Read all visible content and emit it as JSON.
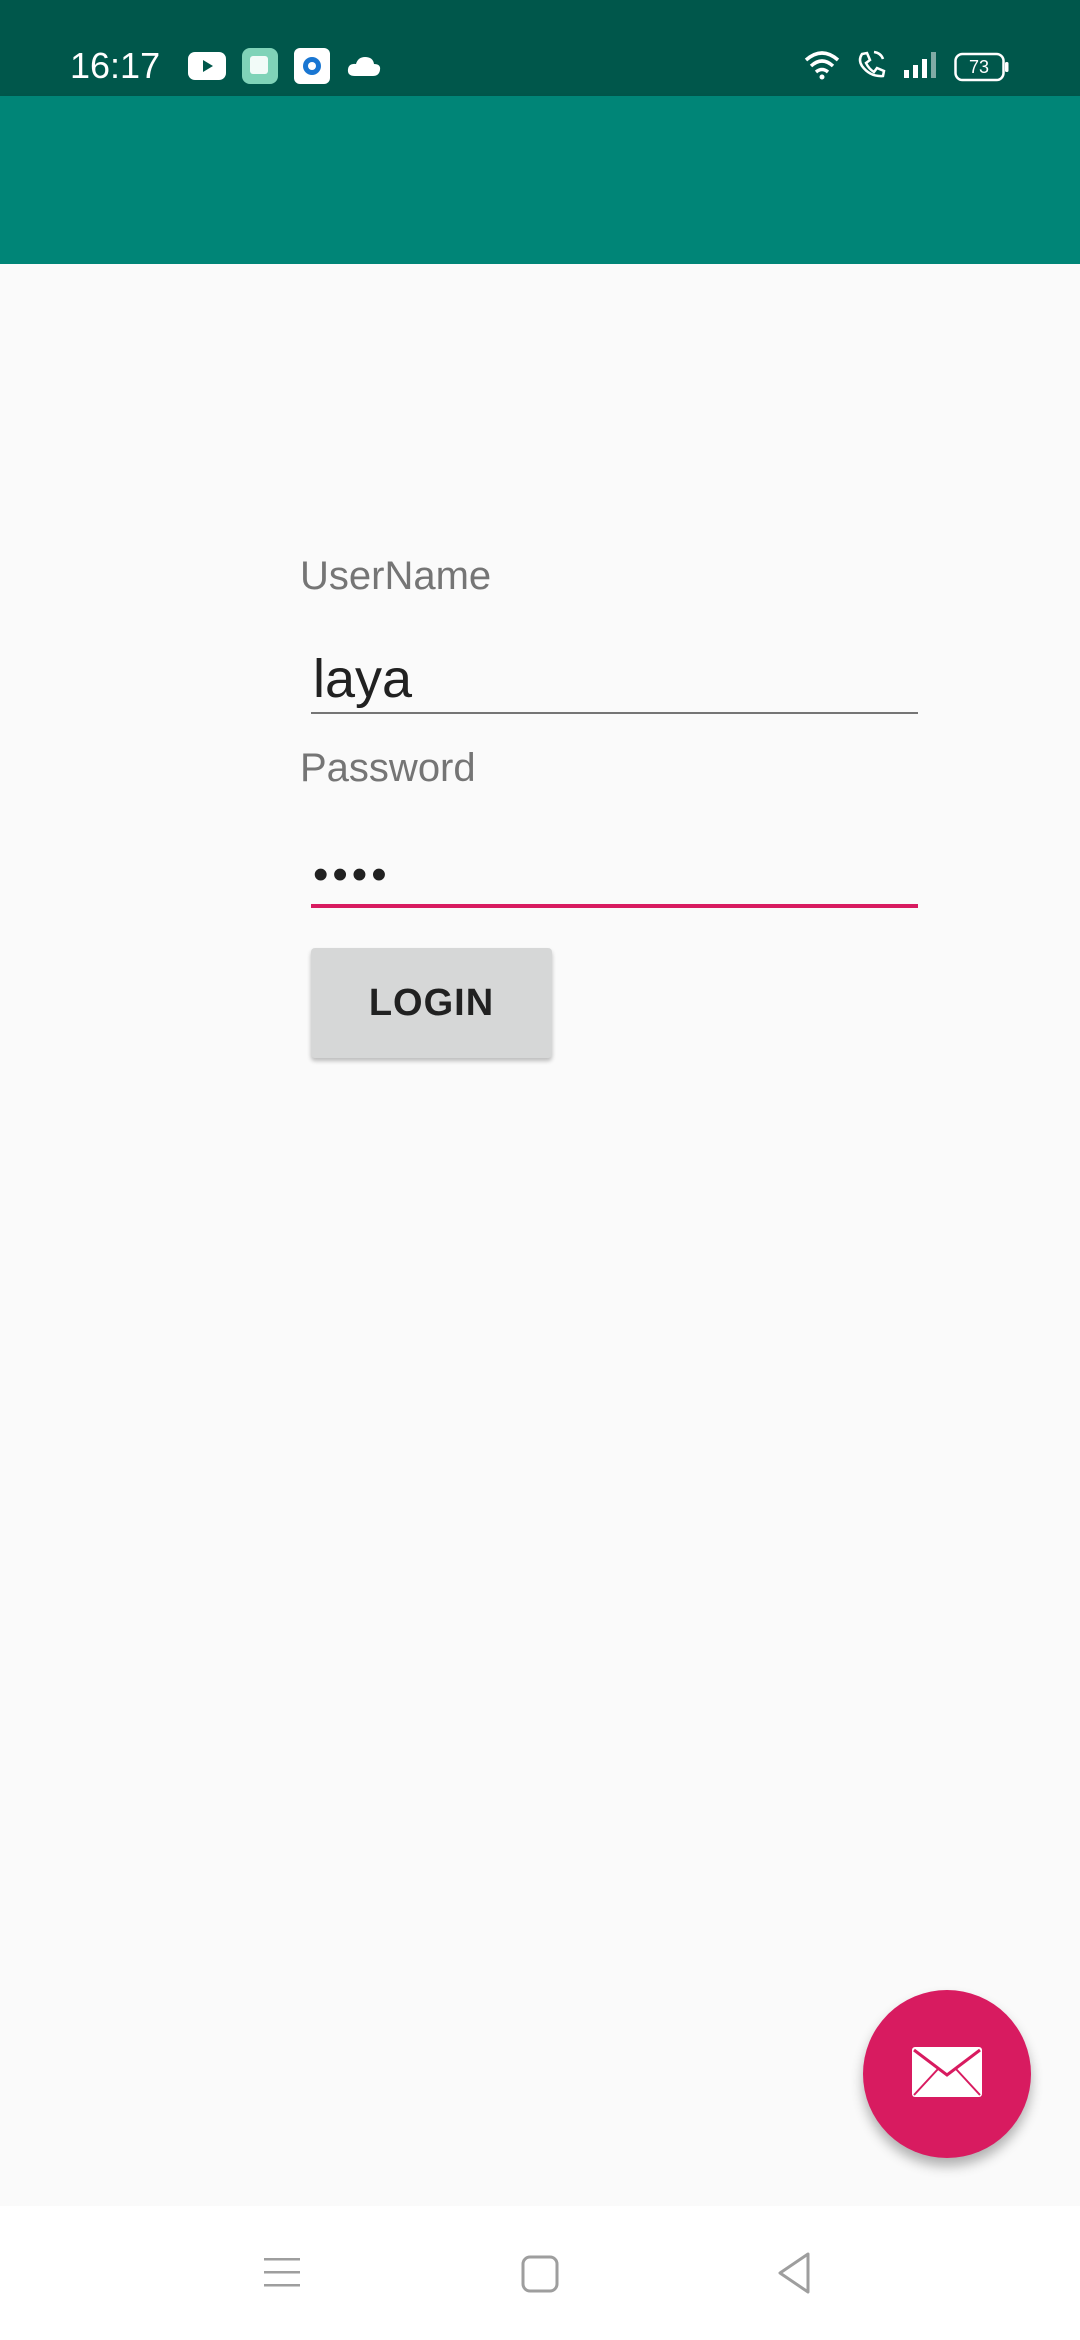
{
  "status_bar": {
    "time": "16:17",
    "app_icons": [
      "youtube-icon",
      "gallery-icon",
      "camera-app-icon",
      "cloud-icon"
    ],
    "right_icons": [
      "wifi-icon",
      "wifi-calling-icon",
      "signal-icon",
      "battery-icon"
    ],
    "battery": "73"
  },
  "form": {
    "username_label": "UserName",
    "username_value": "laya",
    "password_label": "Password",
    "password_value": "••••",
    "login_label": "LOGIN"
  },
  "fab": {
    "icon": "email-icon"
  },
  "nav": {
    "icons": [
      "menu-icon",
      "home-icon",
      "back-icon"
    ]
  },
  "colors": {
    "status_bar": "#00574b",
    "app_bar": "#008577",
    "accent": "#d81b60",
    "background": "#fafafa"
  }
}
